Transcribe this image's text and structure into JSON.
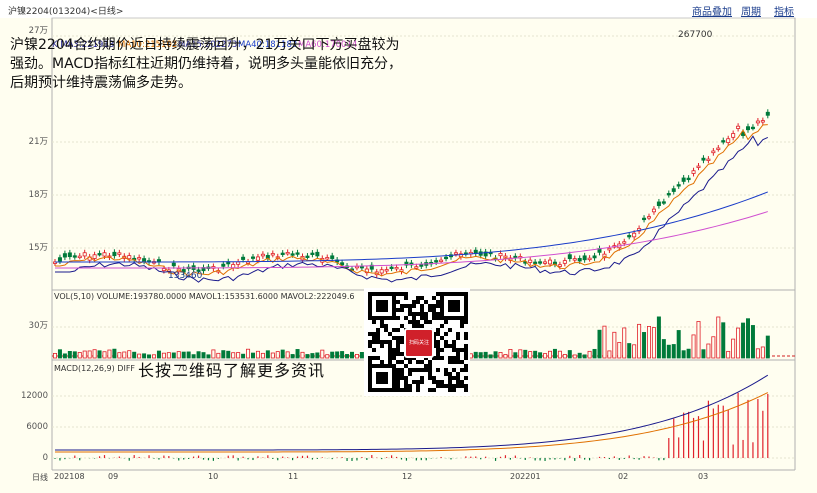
{
  "header": {
    "title": "沪镍2204(013204)<日线>",
    "links": [
      "商品叠加",
      "周期",
      "指标"
    ]
  },
  "price_panel": {
    "ma_legend": [
      {
        "label": "K  MA3:221913",
        "color": "#1a1a8c"
      },
      {
        "label": "MA10:215102",
        "color": "#e07000"
      },
      {
        "label": "MA15:202273",
        "color": "#1a1a8c"
      },
      {
        "label": "MA40:181182",
        "color": "#1a3cc8"
      },
      {
        "label": "MA60:170014",
        "color": "#d050d0"
      }
    ],
    "y_ticks": [
      "27万",
      "21万",
      "18万",
      "15万"
    ],
    "high_marker": "267700",
    "low_marker": "133460"
  },
  "volume_panel": {
    "legend": "VOL(5,10) VOLUME:193780.0000 MAVOL1:153531.6000 MAVOL2:222049.6",
    "y_tick": "30万"
  },
  "macd_panel": {
    "legend": "MACD(12,26,9) DIFF",
    "legend_tail": "70",
    "y_ticks": [
      "12000",
      "6000",
      "0"
    ]
  },
  "x_axis": {
    "label": "日线",
    "ticks": [
      "202108",
      "09",
      "10",
      "11",
      "12",
      "202201",
      "02",
      "03"
    ]
  },
  "annotation": "沪镍2204合约期价近日持续震荡回升，21万关口下方买盘较为强劲。MACD指标红柱近期仍维持着，说明多头量能依旧充分，后期预计维持震荡偏多走势。",
  "qr": {
    "caption": "长按二维码了解更多资讯",
    "logo_text": "扫码关注"
  },
  "colors": {
    "up": "#e0202a",
    "down": "#007a3a",
    "background": "#fffef0"
  }
}
